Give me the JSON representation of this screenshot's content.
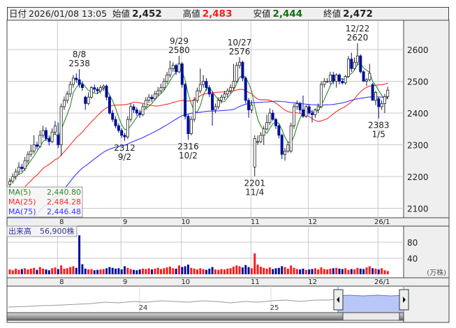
{
  "header": {
    "date_label": "日付",
    "datetime": "2026/01/08 13:05",
    "open_label": "始値",
    "open": "2,452",
    "high_label": "高値",
    "high": "2,483",
    "low_label": "安値",
    "low": "2,444",
    "close_label": "終値",
    "close": "2,472"
  },
  "legend": {
    "ma5_label": "MA(5)",
    "ma5": "2,440.80",
    "ma25_label": "MA(25)",
    "ma25": "2,484.28",
    "ma75_label": "MA(75)",
    "ma75": "2,446.48"
  },
  "volume_panel": {
    "label": "出来高",
    "value": "56,900株",
    "unit": "(万株)"
  },
  "navigator": {
    "labels": [
      "24",
      "25"
    ]
  },
  "colors": {
    "up": "#ff1a1a",
    "down": "#000e99",
    "ma5": "#2a8a2a",
    "ma25": "#ff2a2a",
    "ma75": "#3535ff",
    "grid": "#c8c8c8"
  },
  "chart_data": {
    "type": "candlestick",
    "y_ticks": [
      2100,
      2200,
      2300,
      2400,
      2500,
      2600
    ],
    "ylim": [
      2090,
      2690
    ],
    "x_month_labels": [
      {
        "label": "8",
        "index": 16
      },
      {
        "label": "9",
        "index": 37
      },
      {
        "label": "10",
        "index": 57
      },
      {
        "label": "11",
        "index": 80
      },
      {
        "label": "12",
        "index": 99
      },
      {
        "label": "26/1",
        "index": 122
      }
    ],
    "annotations": [
      {
        "date": "8/8",
        "value": "2538",
        "index": 23,
        "kind": "high"
      },
      {
        "date": "9/2",
        "value": "2312",
        "index": 38,
        "kind": "low"
      },
      {
        "date": "9/29",
        "value": "2580",
        "index": 56,
        "kind": "high"
      },
      {
        "date": "10/2",
        "value": "2316",
        "index": 59,
        "kind": "low"
      },
      {
        "date": "10/27",
        "value": "2576",
        "index": 76,
        "kind": "high"
      },
      {
        "date": "11/4",
        "value": "2201",
        "index": 81,
        "kind": "low"
      },
      {
        "date": "12/22",
        "value": "2620",
        "index": 115,
        "kind": "high"
      },
      {
        "date": "1/5",
        "value": "2383",
        "index": 122,
        "kind": "low"
      }
    ],
    "volume_ticks": [
      40,
      80
    ],
    "volume_unit": "万株",
    "ohlc": [
      [
        2175,
        2195,
        2165,
        2185
      ],
      [
        2185,
        2210,
        2178,
        2200
      ],
      [
        2200,
        2225,
        2190,
        2215
      ],
      [
        2215,
        2245,
        2205,
        2230
      ],
      [
        2230,
        2240,
        2215,
        2225
      ],
      [
        2225,
        2262,
        2218,
        2250
      ],
      [
        2250,
        2280,
        2240,
        2270
      ],
      [
        2270,
        2300,
        2262,
        2280
      ],
      [
        2280,
        2330,
        2272,
        2300
      ],
      [
        2300,
        2310,
        2285,
        2295
      ],
      [
        2295,
        2345,
        2290,
        2330
      ],
      [
        2330,
        2360,
        2322,
        2345
      ],
      [
        2345,
        2355,
        2312,
        2320
      ],
      [
        2320,
        2330,
        2298,
        2310
      ],
      [
        2310,
        2352,
        2305,
        2340
      ],
      [
        2340,
        2375,
        2332,
        2360
      ],
      [
        2330,
        2370,
        2290,
        2300
      ],
      [
        2300,
        2430,
        2265,
        2420
      ],
      [
        2420,
        2452,
        2410,
        2440
      ],
      [
        2440,
        2470,
        2430,
        2460
      ],
      [
        2460,
        2500,
        2450,
        2490
      ],
      [
        2490,
        2520,
        2480,
        2510
      ],
      [
        2510,
        2525,
        2495,
        2505
      ],
      [
        2505,
        2538,
        2480,
        2490
      ],
      [
        2490,
        2500,
        2470,
        2480
      ],
      [
        2450,
        2455,
        2410,
        2430
      ],
      [
        2430,
        2465,
        2425,
        2450
      ],
      [
        2450,
        2485,
        2445,
        2480
      ],
      [
        2480,
        2490,
        2465,
        2475
      ],
      [
        2475,
        2482,
        2460,
        2470
      ],
      [
        2470,
        2488,
        2462,
        2480
      ],
      [
        2480,
        2490,
        2470,
        2485
      ],
      [
        2485,
        2490,
        2440,
        2450
      ],
      [
        2450,
        2455,
        2395,
        2400
      ],
      [
        2400,
        2410,
        2372,
        2380
      ],
      [
        2380,
        2390,
        2352,
        2360
      ],
      [
        2360,
        2368,
        2338,
        2345
      ],
      [
        2345,
        2352,
        2322,
        2330
      ],
      [
        2330,
        2338,
        2312,
        2325
      ],
      [
        2325,
        2390,
        2318,
        2380
      ],
      [
        2380,
        2432,
        2372,
        2420
      ],
      [
        2420,
        2428,
        2400,
        2410
      ],
      [
        2410,
        2418,
        2392,
        2400
      ],
      [
        2400,
        2410,
        2385,
        2395
      ],
      [
        2395,
        2428,
        2390,
        2420
      ],
      [
        2420,
        2450,
        2412,
        2440
      ],
      [
        2440,
        2460,
        2432,
        2450
      ],
      [
        2450,
        2458,
        2435,
        2445
      ],
      [
        2445,
        2470,
        2440,
        2460
      ],
      [
        2460,
        2482,
        2452,
        2470
      ],
      [
        2470,
        2492,
        2462,
        2480
      ],
      [
        2480,
        2510,
        2472,
        2500
      ],
      [
        2500,
        2530,
        2492,
        2520
      ],
      [
        2520,
        2565,
        2512,
        2540
      ],
      [
        2540,
        2560,
        2530,
        2550
      ],
      [
        2550,
        2555,
        2520,
        2530
      ],
      [
        2530,
        2580,
        2525,
        2555
      ],
      [
        2555,
        2560,
        2480,
        2490
      ],
      [
        2490,
        2495,
        2380,
        2390
      ],
      [
        2390,
        2395,
        2316,
        2335
      ],
      [
        2335,
        2390,
        2330,
        2380
      ],
      [
        2380,
        2450,
        2372,
        2440
      ],
      [
        2440,
        2480,
        2432,
        2470
      ],
      [
        2470,
        2540,
        2462,
        2490
      ],
      [
        2490,
        2520,
        2480,
        2500
      ],
      [
        2500,
        2510,
        2470,
        2480
      ],
      [
        2480,
        2488,
        2450,
        2460
      ],
      [
        2460,
        2468,
        2360,
        2410
      ],
      [
        2410,
        2430,
        2400,
        2420
      ],
      [
        2420,
        2450,
        2412,
        2440
      ],
      [
        2440,
        2458,
        2430,
        2450
      ],
      [
        2450,
        2470,
        2442,
        2460
      ],
      [
        2460,
        2478,
        2450,
        2470
      ],
      [
        2470,
        2490,
        2462,
        2480
      ],
      [
        2480,
        2555,
        2472,
        2500
      ],
      [
        2500,
        2560,
        2495,
        2550
      ],
      [
        2550,
        2576,
        2540,
        2560
      ],
      [
        2560,
        2565,
        2500,
        2510
      ],
      [
        2510,
        2515,
        2430,
        2440
      ],
      [
        2440,
        2448,
        2385,
        2410
      ],
      [
        2410,
        2440,
        2400,
        2425
      ],
      [
        2230,
        2330,
        2201,
        2320
      ],
      [
        2310,
        2330,
        2300,
        2310
      ],
      [
        2310,
        2340,
        2305,
        2330
      ],
      [
        2330,
        2360,
        2300,
        2350
      ],
      [
        2350,
        2395,
        2345,
        2370
      ],
      [
        2370,
        2415,
        2362,
        2400
      ],
      [
        2400,
        2410,
        2375,
        2380
      ],
      [
        2380,
        2385,
        2350,
        2360
      ],
      [
        2360,
        2365,
        2320,
        2330
      ],
      [
        2330,
        2335,
        2255,
        2270
      ],
      [
        2270,
        2290,
        2250,
        2280
      ],
      [
        2280,
        2310,
        2275,
        2300
      ],
      [
        2280,
        2370,
        2275,
        2360
      ],
      [
        2360,
        2430,
        2350,
        2420
      ],
      [
        2420,
        2440,
        2410,
        2430
      ],
      [
        2430,
        2435,
        2400,
        2410
      ],
      [
        2410,
        2455,
        2385,
        2390
      ],
      [
        2390,
        2425,
        2385,
        2420
      ],
      [
        2420,
        2428,
        2395,
        2400
      ],
      [
        2400,
        2410,
        2370,
        2395
      ],
      [
        2395,
        2415,
        2385,
        2410
      ],
      [
        2410,
        2430,
        2400,
        2420
      ],
      [
        2420,
        2500,
        2415,
        2490
      ],
      [
        2490,
        2510,
        2480,
        2500
      ],
      [
        2500,
        2510,
        2495,
        2500
      ],
      [
        2500,
        2530,
        2490,
        2520
      ],
      [
        2520,
        2530,
        2490,
        2500
      ],
      [
        2500,
        2525,
        2480,
        2520
      ],
      [
        2520,
        2525,
        2490,
        2500
      ],
      [
        2500,
        2510,
        2490,
        2495
      ],
      [
        2495,
        2520,
        2490,
        2515
      ],
      [
        2515,
        2580,
        2510,
        2570
      ],
      [
        2570,
        2590,
        2530,
        2540
      ],
      [
        2540,
        2575,
        2535,
        2560
      ],
      [
        2560,
        2620,
        2550,
        2580
      ],
      [
        2580,
        2585,
        2525,
        2530
      ],
      [
        2530,
        2535,
        2500,
        2500
      ],
      [
        2500,
        2510,
        2485,
        2505
      ],
      [
        2505,
        2555,
        2500,
        2525
      ],
      [
        2490,
        2495,
        2440,
        2440
      ],
      [
        2440,
        2470,
        2425,
        2465
      ],
      [
        2445,
        2450,
        2383,
        2420
      ],
      [
        2420,
        2440,
        2410,
        2430
      ],
      [
        2430,
        2460,
        2400,
        2452
      ],
      [
        2452,
        2483,
        2444,
        2472
      ]
    ],
    "volume": [
      12,
      10,
      14,
      11,
      13,
      15,
      12,
      14,
      16,
      11,
      18,
      14,
      12,
      10,
      15,
      17,
      13,
      22,
      14,
      15,
      18,
      20,
      16,
      97,
      25,
      14,
      12,
      13,
      10,
      11,
      12,
      13,
      15,
      18,
      16,
      14,
      15,
      12,
      20,
      16,
      13,
      11,
      10,
      12,
      14,
      13,
      15,
      12,
      14,
      16,
      13,
      15,
      17,
      19,
      15,
      14,
      22,
      18,
      20,
      24,
      16,
      14,
      12,
      15,
      13,
      11,
      14,
      18,
      12,
      11,
      13,
      12,
      14,
      15,
      19,
      22,
      20,
      17,
      23,
      18,
      15,
      52,
      24,
      19,
      16,
      14,
      17,
      13,
      15,
      16,
      20,
      18,
      14,
      22,
      16,
      13,
      12,
      14,
      11,
      12,
      13,
      15,
      12,
      17,
      13,
      12,
      14,
      15,
      16,
      14,
      13,
      15,
      11,
      13,
      12,
      16,
      14,
      13,
      17,
      20,
      15,
      14,
      12,
      15,
      10,
      8
    ]
  }
}
